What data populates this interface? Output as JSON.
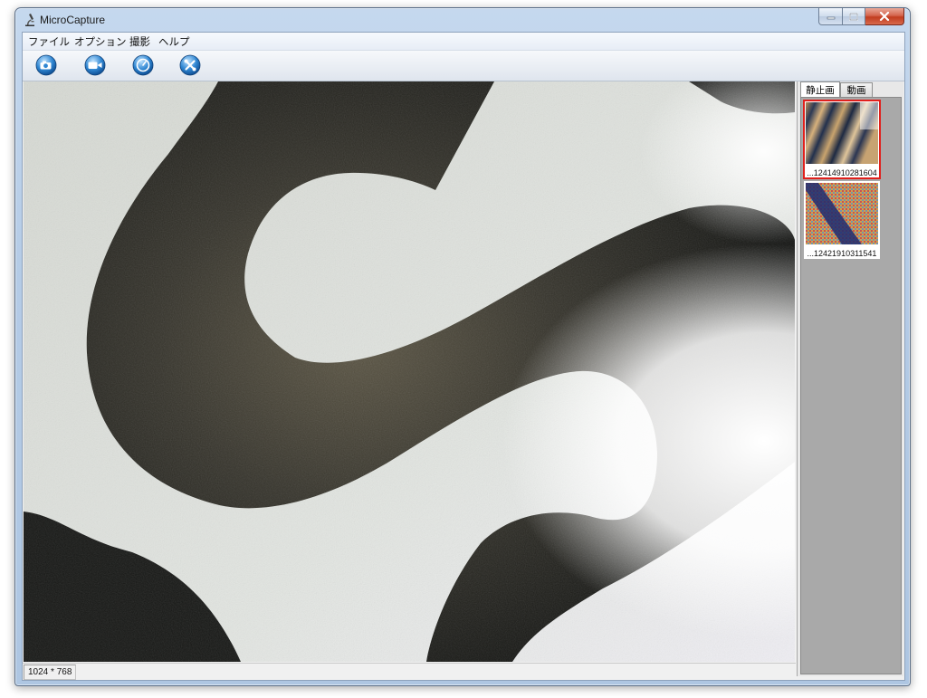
{
  "window": {
    "title": "MicroCapture"
  },
  "menu": [
    {
      "label": "ファイル"
    },
    {
      "label": "オプション"
    },
    {
      "label": "撮影"
    },
    {
      "label": "ヘルプ"
    }
  ],
  "toolbar": {
    "buttons": [
      {
        "icon": "snapshot-icon"
      },
      {
        "icon": "video-record-icon"
      },
      {
        "icon": "timer-icon"
      },
      {
        "icon": "settings-icon"
      }
    ]
  },
  "panel": {
    "tabs": [
      {
        "label": "静止画",
        "active": true
      },
      {
        "label": "動画",
        "active": false
      }
    ],
    "thumbnails": [
      {
        "label": "...12414910281604",
        "selected": true
      },
      {
        "label": "...12421910311541",
        "selected": false
      }
    ]
  },
  "status": {
    "resolution": "1024 * 768"
  },
  "colors": {
    "selection": "#e0201c",
    "panel_bg": "#a9a9a9"
  }
}
